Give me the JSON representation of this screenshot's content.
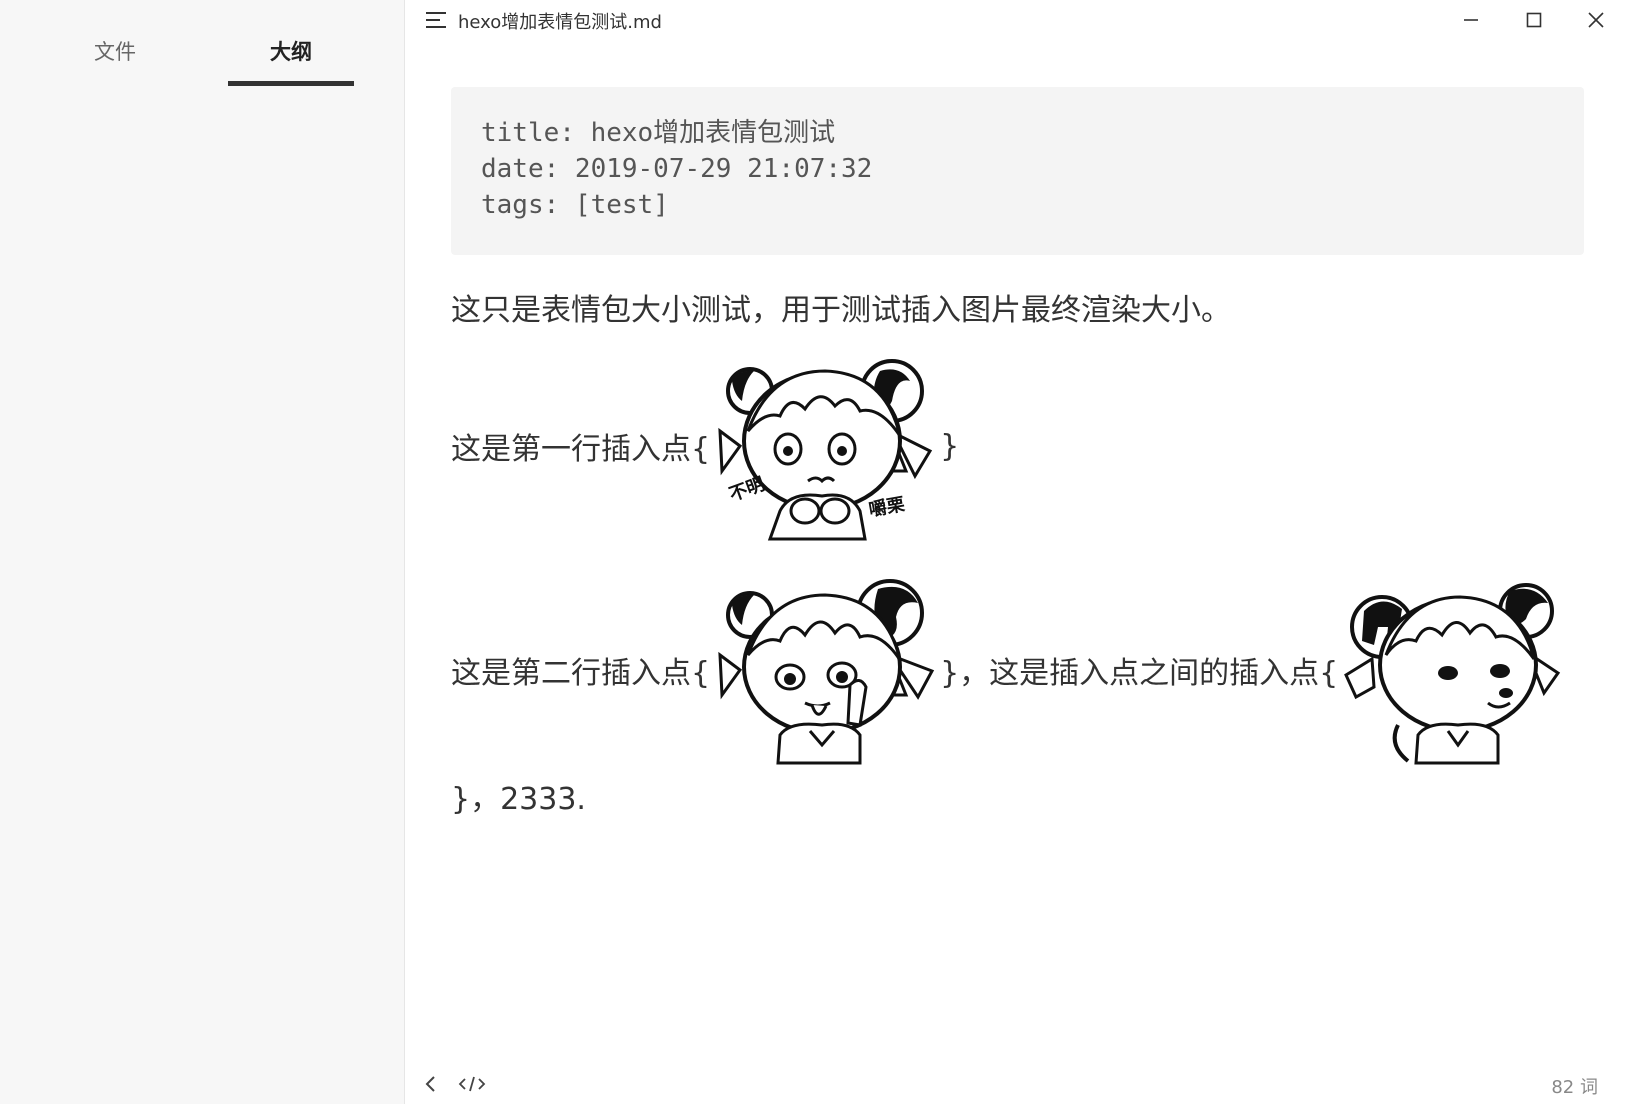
{
  "sidebar": {
    "tabs": [
      {
        "label": "文件",
        "active": false
      },
      {
        "label": "大纲",
        "active": true
      }
    ]
  },
  "titlebar": {
    "title": "hexo增加表情包测试.md"
  },
  "editor": {
    "frontmatter": [
      "title: hexo增加表情包测试",
      "date: 2019-07-29 21:07:32",
      "tags: [test]"
    ],
    "paragraph1": "这只是表情包大小测试，用于测试插入图片最终渲染大小。",
    "row1": {
      "before": "这是第一行插入点{",
      "after": "}"
    },
    "row2": {
      "before": "这是第二行插入点{",
      "middle": "}，这是插入点之间的插入点{"
    },
    "last_line": "}，2333.",
    "sticker1_text": [
      "不明",
      "嚼栗"
    ]
  },
  "footer": {
    "word_count": "82 词"
  },
  "icons": {
    "menu": "menu-icon",
    "minimize": "minimize-icon",
    "maximize": "maximize-icon",
    "close": "close-icon",
    "back": "chevron-left-icon",
    "source": "code-icon"
  }
}
